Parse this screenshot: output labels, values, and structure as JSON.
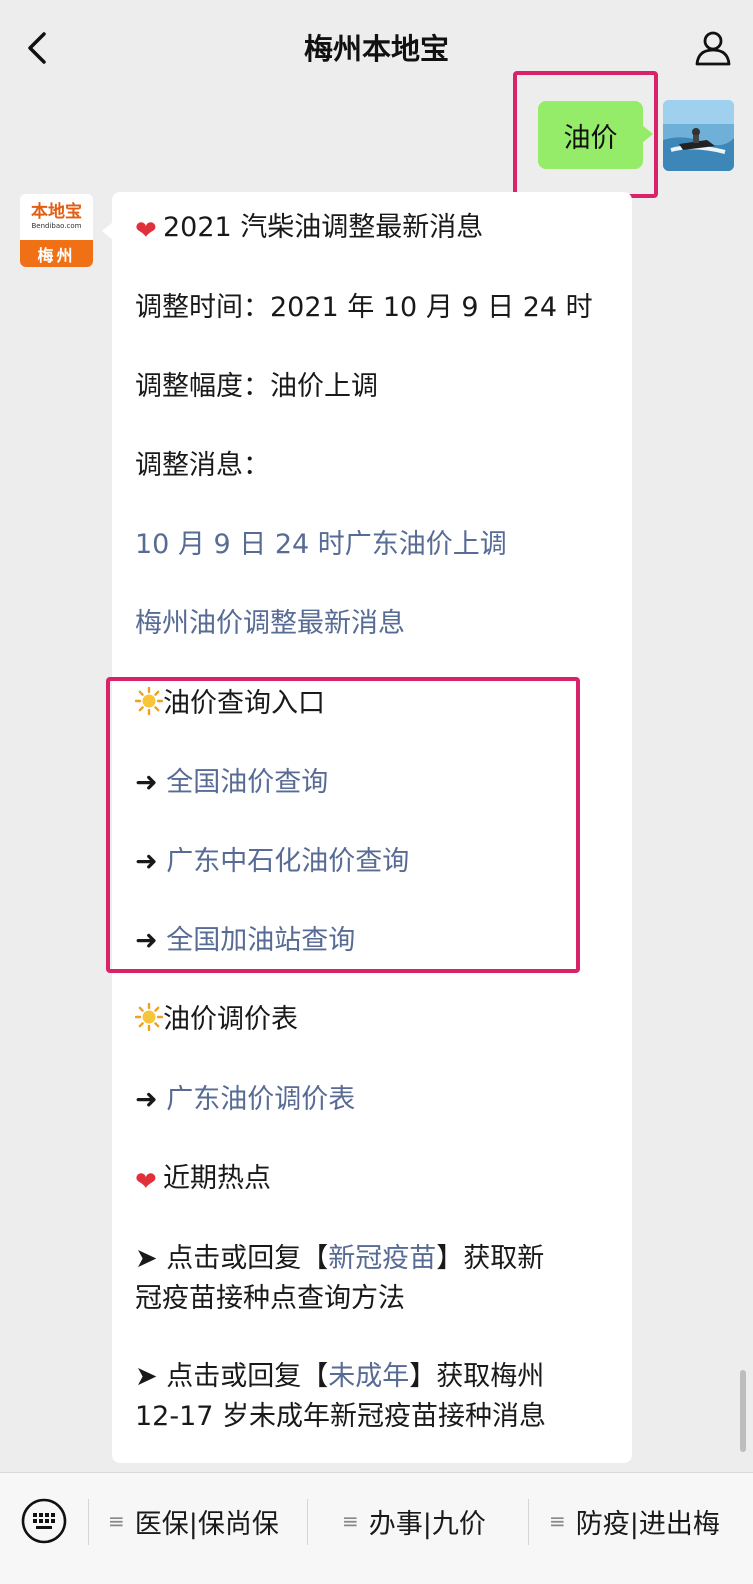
{
  "nav": {
    "title": "梅州本地宝"
  },
  "user_message": {
    "text": "油价"
  },
  "bot": {
    "logo_text": "本地宝",
    "logo_sub": "Bendibao.com",
    "logo_city": "梅州",
    "lines": {
      "l1": "2021 汽柴油调整最新消息",
      "l2": "调整时间：2021 年 10 月 9 日 24 时",
      "l3": "调整幅度：油价上调",
      "l4": "调整消息：",
      "l5": "10 月 9 日 24 时广东油价上调",
      "l6": "梅州油价调整最新消息",
      "l7": "油价查询入口",
      "l8": "全国油价查询",
      "l9": "广东中石化油价查询",
      "l10": "全国加油站查询",
      "l11": "油价调价表",
      "l12": "广东油价调价表",
      "l13": "近期热点",
      "l14a": "点击或回复【",
      "l14b": "新冠疫苗",
      "l14c": "】获取新",
      "l15": "冠疫苗接种点查询方法",
      "l16a": "点击或回复【",
      "l16b": "未成年",
      "l16c": "】获取梅州",
      "l17": "12-17 岁未成年新冠疫苗接种消息"
    },
    "glyphs": {
      "heart": "❤",
      "arrow": "➜",
      "pointer": "➤"
    }
  },
  "menu": {
    "items": [
      "医保|保尚保",
      "办事|九价",
      "防疫|进出梅"
    ]
  },
  "colors": {
    "bubble_me": "#95ec69",
    "link": "#576b95",
    "highlight": "#d8226a"
  }
}
